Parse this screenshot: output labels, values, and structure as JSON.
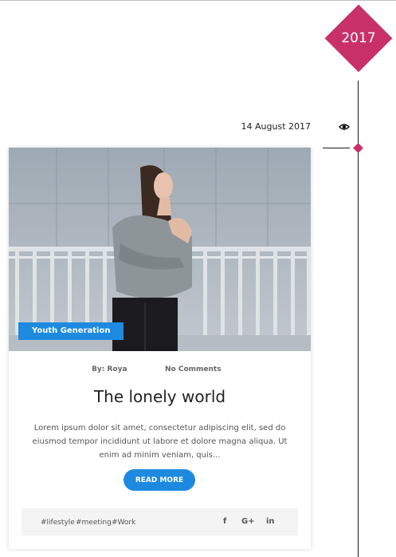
{
  "timeline": {
    "year": "2017",
    "accent_color": "#c8306a"
  },
  "post": {
    "date": "14 August 2017",
    "view_icon": "eye-icon",
    "category": "Youth Generation",
    "author": "By: Roya",
    "comments": "No Comments",
    "title": "The lonely world",
    "excerpt": "Lorem ipsum dolor sit amet, consectetur adipiscing elit, sed do eiusmod tempor incididunt ut labore et dolore magna aliqua. Ut enim ad minim veniam, quis...",
    "read_more_label": "READ MORE",
    "button_color": "#1d8ae0",
    "tags": [
      "#lifestyle",
      "#meeting",
      "#Work"
    ],
    "social": [
      {
        "icon": "facebook-icon",
        "glyph": "f"
      },
      {
        "icon": "google-plus-icon",
        "glyph": "G+"
      },
      {
        "icon": "linkedin-icon",
        "glyph": "in"
      }
    ]
  }
}
